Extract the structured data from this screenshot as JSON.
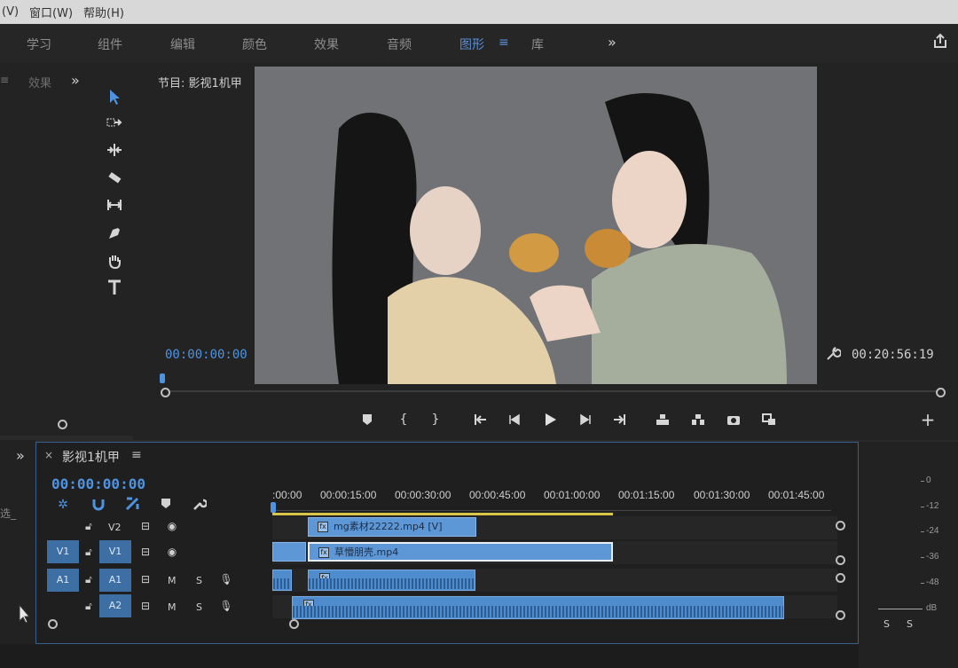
{
  "menu": {
    "items": [
      "(V)",
      "窗口(W)",
      "帮助(H)"
    ]
  },
  "workspaces": {
    "items": [
      "学习",
      "组件",
      "编辑",
      "颜色",
      "效果",
      "音频",
      "图形",
      "库"
    ],
    "active": "图形"
  },
  "left_panel": {
    "tab": "效果"
  },
  "monitor": {
    "title": "节目: 影视1机甲",
    "timecode_current": "00:00:00:00",
    "timecode_duration": "00:20:56:19"
  },
  "timeline": {
    "sequence_name": "影视1机甲",
    "timecode": "00:00:00:00",
    "ruler": [
      ":00:00",
      "00:00:15:00",
      "00:00:30:00",
      "00:00:45:00",
      "00:01:00:00",
      "00:01:15:00",
      "00:01:30:00",
      "00:01:45:00"
    ],
    "tracks": {
      "v2": {
        "label": "V2"
      },
      "v1": {
        "src": "V1",
        "label": "V1"
      },
      "a1": {
        "src": "A1",
        "label": "A1",
        "m": "M",
        "s": "S"
      },
      "a2": {
        "label": "A2",
        "m": "M",
        "s": "S"
      }
    },
    "clips": {
      "v2_clip": "mg素材22222.mp4 [V]",
      "v1_clip": "草懵朋壳.mp4"
    }
  },
  "meter": {
    "labels": [
      "0",
      "-12",
      "-24",
      "-36",
      "-48",
      "dB"
    ],
    "solo": [
      "S",
      "S"
    ]
  },
  "colors": {
    "accent": "#4e93e0",
    "clip": "#5d97d6",
    "playhead_bar": "#d7c64a"
  }
}
